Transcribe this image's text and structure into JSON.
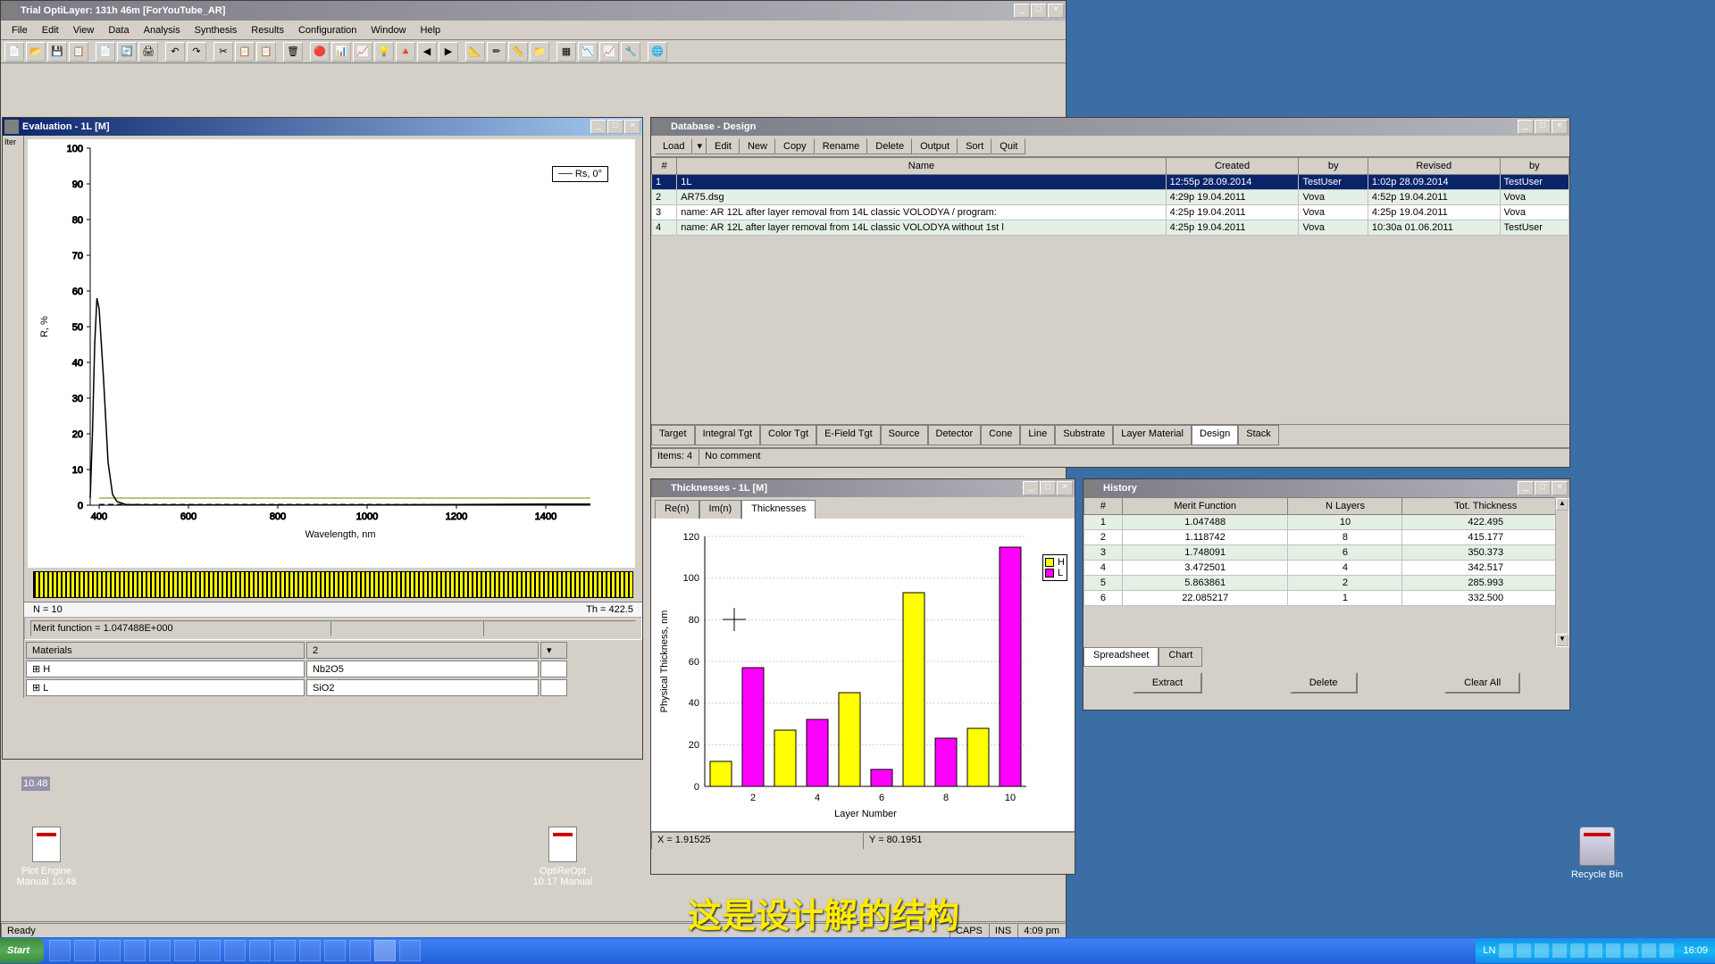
{
  "app": {
    "title": "Trial OptiLayer: 131h 46m   [ForYouTube_AR]",
    "status": "Ready",
    "caps": "CAPS",
    "ins": "INS",
    "time": "4:09 pm"
  },
  "menu": [
    "File",
    "Edit",
    "View",
    "Data",
    "Analysis",
    "Synthesis",
    "Results",
    "Configuration",
    "Window",
    "Help"
  ],
  "evaluation": {
    "title": "Evaluation - 1L [M]",
    "legend": "── Rs, 0°",
    "ylabel": "R, %",
    "xlabel": "Wavelength, nm",
    "n_label": "N = 10",
    "th_label": "Th = 422.5",
    "merit": "Merit function =  1.047488E+000",
    "materials_hdr": "Materials",
    "materials_count": "2",
    "mat_rows": [
      {
        "sym": "H",
        "name": "Nb2O5"
      },
      {
        "sym": "L",
        "name": "SiO2"
      }
    ]
  },
  "chart_data": [
    {
      "type": "line",
      "title": "Evaluation - 1L [M]",
      "xlabel": "Wavelength, nm",
      "ylabel": "R, %",
      "xlim": [
        380,
        1500
      ],
      "ylim": [
        0,
        100
      ],
      "x_ticks": [
        400,
        600,
        800,
        1000,
        1200,
        1400
      ],
      "y_ticks": [
        0,
        10,
        20,
        30,
        40,
        50,
        60,
        70,
        80,
        90,
        100
      ],
      "series": [
        {
          "name": "Rs, 0°",
          "x": [
            380,
            385,
            390,
            395,
            400,
            410,
            420,
            430,
            440,
            460,
            500,
            600,
            800,
            1000,
            1200,
            1400,
            1500
          ],
          "y": [
            2,
            20,
            45,
            58,
            55,
            35,
            12,
            3,
            1,
            0.2,
            0.1,
            0.1,
            0.1,
            0.1,
            0.2,
            0.3,
            0.3
          ]
        }
      ],
      "target_line": {
        "y": 0,
        "x_range": [
          400,
          1500
        ],
        "style": "dashed"
      }
    },
    {
      "type": "bar",
      "title": "Thicknesses - 1L [M]",
      "xlabel": "Layer Number",
      "ylabel": "Physical Thickness, nm",
      "xlim": [
        1,
        10
      ],
      "ylim": [
        0,
        120
      ],
      "x_ticks": [
        2,
        4,
        6,
        8,
        10
      ],
      "y_ticks": [
        0,
        20,
        40,
        60,
        80,
        100,
        120
      ],
      "categories": [
        1,
        2,
        3,
        4,
        5,
        6,
        7,
        8,
        9,
        10
      ],
      "series": [
        {
          "name": "H",
          "color": "#ffff00",
          "values": [
            12,
            null,
            27,
            null,
            45,
            null,
            93,
            null,
            28,
            null
          ]
        },
        {
          "name": "L",
          "color": "#ff00ff",
          "values": [
            null,
            57,
            null,
            32,
            null,
            8,
            null,
            23,
            null,
            115
          ]
        }
      ],
      "combined_values": [
        12,
        57,
        27,
        32,
        45,
        8,
        93,
        23,
        28,
        115
      ],
      "combined_material": [
        "H",
        "L",
        "H",
        "L",
        "H",
        "L",
        "H",
        "L",
        "H",
        "L"
      ]
    }
  ],
  "database": {
    "title": "Database - Design",
    "buttons": [
      "Load",
      "Edit",
      "New",
      "Copy",
      "Rename",
      "Delete",
      "Output",
      "Sort",
      "Quit"
    ],
    "cols": [
      "#",
      "Name",
      "Created",
      "by",
      "Revised",
      "by"
    ],
    "rows": [
      {
        "n": "1",
        "name": "1L",
        "created": "12:55p 28.09.2014",
        "cby": "TestUser",
        "revised": "1:02p 28.09.2014",
        "rby": "TestUser",
        "sel": true
      },
      {
        "n": "2",
        "name": "AR75.dsg",
        "created": "4:29p 19.04.2011",
        "cby": "Vova",
        "revised": "4:52p 19.04.2011",
        "rby": "Vova"
      },
      {
        "n": "3",
        "name": "name:  AR 12L after layer removal from 14L classic VOLODYA / program:",
        "created": "4:25p 19.04.2011",
        "cby": "Vova",
        "revised": "4:25p 19.04.2011",
        "rby": "Vova"
      },
      {
        "n": "4",
        "name": "name:  AR 12L after layer removal from 14L classic VOLODYA without 1st l",
        "created": "4:25p 19.04.2011",
        "cby": "Vova",
        "revised": "10:30a 01.06.2011",
        "rby": "TestUser"
      }
    ],
    "tabs": [
      "Target",
      "Integral Tgt",
      "Color Tgt",
      "E-Field Tgt",
      "Source",
      "Detector",
      "Cone",
      "Line",
      "Substrate",
      "Layer Material",
      "Design",
      "Stack"
    ],
    "active_tab": "Design",
    "items": "Items: 4",
    "comment": "No comment"
  },
  "thickness": {
    "title": "Thicknesses - 1L [M]",
    "tabs": [
      "Re(n)",
      "Im(n)",
      "Thicknesses"
    ],
    "active_tab": "Thicknesses",
    "legend": [
      {
        "label": "H",
        "color": "#ffff00"
      },
      {
        "label": "L",
        "color": "#ff00ff"
      }
    ],
    "xlabel": "Layer Number",
    "status_x": "X = 1.91525",
    "status_y": "Y = 80.1951"
  },
  "history": {
    "title": "History",
    "cols": [
      "#",
      "Merit Function",
      "N Layers",
      "Tot. Thickness"
    ],
    "rows": [
      {
        "n": "1",
        "mf": "1.047488",
        "nl": "10",
        "tt": "422.495"
      },
      {
        "n": "2",
        "mf": "1.118742",
        "nl": "8",
        "tt": "415.177"
      },
      {
        "n": "3",
        "mf": "1.748091",
        "nl": "6",
        "tt": "350.373"
      },
      {
        "n": "4",
        "mf": "3.472501",
        "nl": "4",
        "tt": "342.517"
      },
      {
        "n": "5",
        "mf": "5.863861",
        "nl": "2",
        "tt": "285.993"
      },
      {
        "n": "6",
        "mf": "22.085217",
        "nl": "1",
        "tt": "332.500"
      }
    ],
    "tabs": [
      "Spreadsheet",
      "Chart"
    ],
    "active_tab": "Spreadsheet",
    "buttons": [
      "Extract",
      "Delete",
      "Clear All"
    ]
  },
  "desktop": {
    "icon1": "Plot Engine Manual 10.48",
    "icon2": "OptiReOpt 10.17 Manual",
    "icon3": "Recycle Bin",
    "version": "10.48"
  },
  "subtitle": "这是设计解的结构",
  "taskbar": {
    "start": "Start",
    "lang": "LN",
    "clock": "16:09"
  }
}
